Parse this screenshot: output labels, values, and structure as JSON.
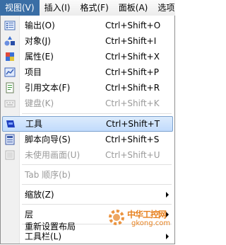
{
  "menubar": {
    "items": [
      {
        "label": "视图(V)",
        "active": true
      },
      {
        "label": "插入(I)",
        "active": false
      },
      {
        "label": "格式(F)",
        "active": false
      },
      {
        "label": "面板(A)",
        "active": false
      },
      {
        "label": "选项(",
        "active": false
      }
    ]
  },
  "menu": {
    "items": [
      {
        "label": "输出(O)",
        "shortcut": "Ctrl+Shift+O",
        "icon": "output-icon"
      },
      {
        "label": "对象(J)",
        "shortcut": "Ctrl+Shift+I",
        "icon": "objects-icon"
      },
      {
        "label": "属性(E)",
        "shortcut": "Ctrl+Shift+X",
        "icon": "properties-icon"
      },
      {
        "label": "项目",
        "shortcut": "Ctrl+Shift+P",
        "icon": "project-icon"
      },
      {
        "label": "引用文本(F)",
        "shortcut": "Ctrl+Shift+R",
        "icon": "reference-text-icon"
      },
      {
        "label": "键盘(K)",
        "shortcut": "Ctrl+Shift+K",
        "icon": "keyboard-icon",
        "disabled": true
      },
      {
        "label": "工具",
        "shortcut": "Ctrl+Shift+T",
        "icon": "tools-icon",
        "highlighted": true
      },
      {
        "label": "脚本向导(S)",
        "shortcut": "Ctrl+Shift+S",
        "icon": "script-wizard-icon"
      },
      {
        "label": "未使用画面(U)",
        "shortcut": "Ctrl+Shift+U",
        "icon": "unused-screens-icon",
        "disabled": true
      },
      {
        "label": "Tab 顺序(b)",
        "disabled": true
      },
      {
        "label": "缩放(Z)",
        "submenu": true
      },
      {
        "label": "层",
        "submenu": true
      },
      {
        "label": "重新设置布局"
      },
      {
        "label": "工具栏(L)",
        "submenu": true
      }
    ]
  },
  "watermark": {
    "title": "中华工控网",
    "domain": "gkong.com"
  },
  "colors": {
    "highlight_top": "#dcebfc",
    "highlight_bottom": "#c1dbfc",
    "highlight_border": "#7da2ce",
    "disabled_text": "#9a9a9a",
    "watermark": "#e7811f"
  }
}
